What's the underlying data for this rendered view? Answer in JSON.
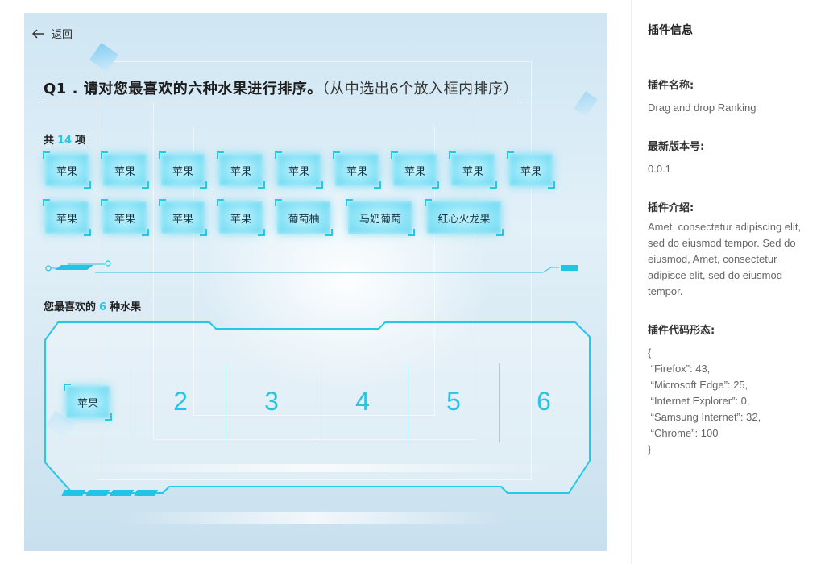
{
  "back_label": "返回",
  "question": {
    "title": "Q1 . 请对您最喜欢的六种水果进行排序。",
    "hint": "（从中选出6个放入框内排序）"
  },
  "pool": {
    "prefix": "共",
    "count": "14",
    "suffix": "项",
    "items": [
      "苹果",
      "苹果",
      "苹果",
      "苹果",
      "苹果",
      "苹果",
      "苹果",
      "苹果",
      "苹果",
      "苹果",
      "苹果",
      "苹果",
      "苹果",
      "葡萄柚",
      "马奶葡萄",
      "红心火龙果"
    ]
  },
  "ranking": {
    "prefix": "您最喜欢的",
    "count": "6",
    "suffix": "种水果",
    "slot1_item": "苹果",
    "slot_numbers": [
      "2",
      "3",
      "4",
      "5",
      "6"
    ]
  },
  "panel": {
    "title": "插件信息",
    "name_label": "插件名称:",
    "name_value": "Drag and drop Ranking",
    "version_label": "最新版本号:",
    "version_value": "0.0.1",
    "intro_label": "插件介绍:",
    "intro_value": "Amet, consectetur adipiscing elit, sed do eiusmod tempor. Sed do eiusmod, Amet, consectetur adipisce elit, sed do eiusmod tempor.",
    "code_label": "插件代码形态:",
    "code_lines": [
      "{",
      " “Firefox”: 43,",
      " “Microsoft Edge”: 25,",
      " “Internet Explorer”: 0,",
      " “Samsung Internet”: 32,",
      " “Chrome”: 100",
      "}"
    ]
  },
  "colors": {
    "accent": "#25c6e6",
    "chip_glow": "#8fe4f7"
  }
}
